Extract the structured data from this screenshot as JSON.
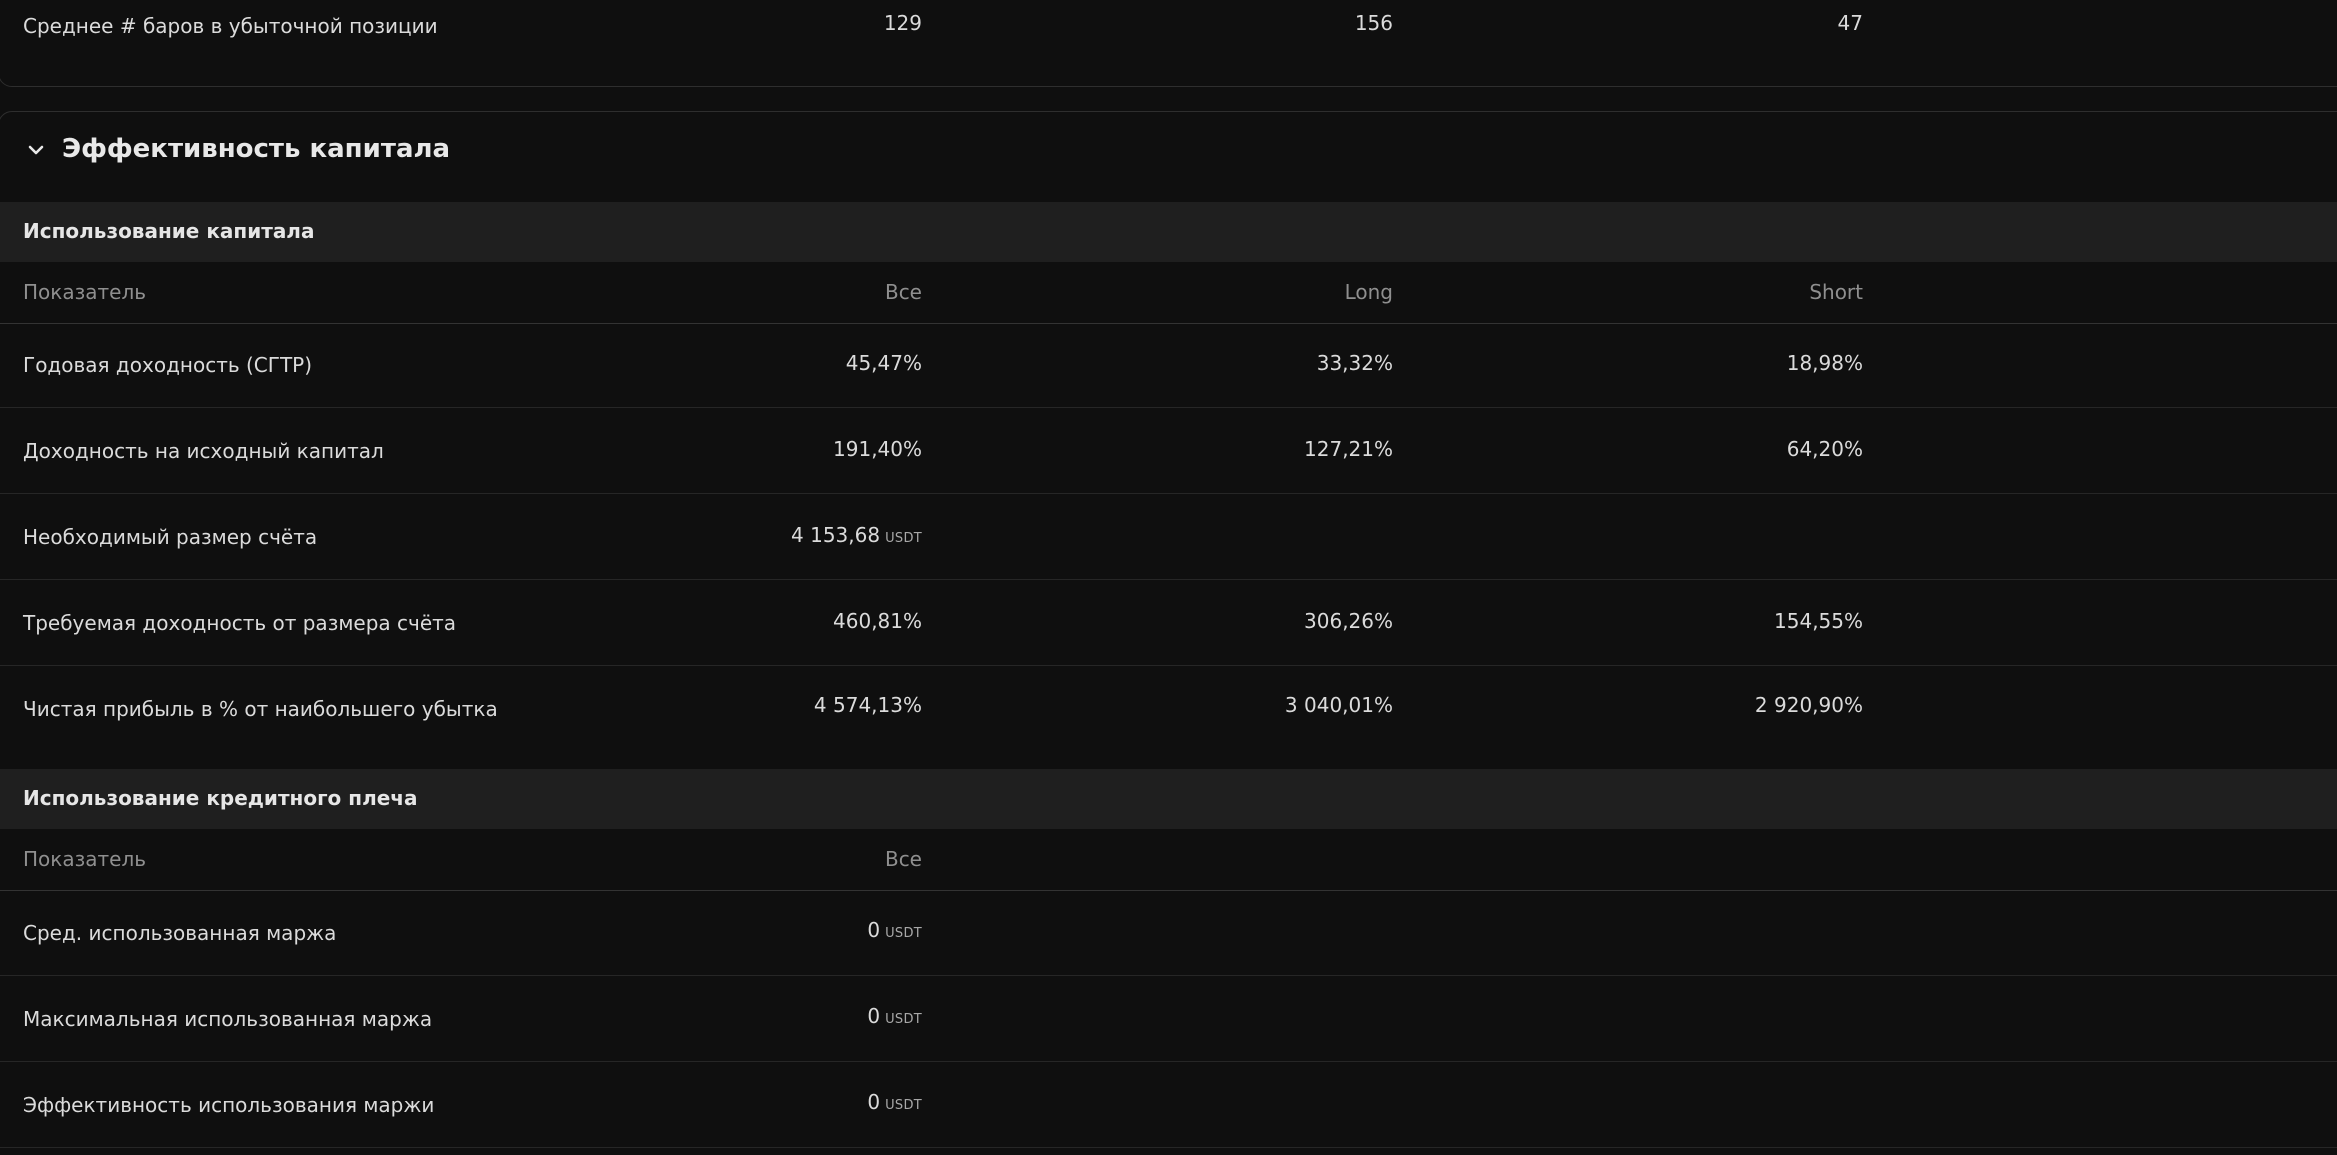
{
  "top_row": {
    "label": "Среднее # баров в убыточной позиции",
    "all": "129",
    "long": "156",
    "short": "47"
  },
  "section": {
    "title": "Эффективность капитала",
    "toggle_icon": "chevron-down-icon"
  },
  "capital_usage": {
    "title": "Использование капитала",
    "headers": {
      "metric": "Показатель",
      "all": "Все",
      "long": "Long",
      "short": "Short"
    },
    "rows": [
      {
        "label": "Годовая доходность (CГТР)",
        "all": "45,47%",
        "long": "33,32%",
        "short": "18,98%"
      },
      {
        "label": "Доходность на исходный капитал",
        "all": "191,40%",
        "long": "127,21%",
        "short": "64,20%"
      },
      {
        "label": "Необходимый размер счёта",
        "all": "4 153,68",
        "all_unit": "USDT",
        "long": "",
        "short": ""
      },
      {
        "label": "Требуемая доходность от размера счёта",
        "all": "460,81%",
        "long": "306,26%",
        "short": "154,55%"
      },
      {
        "label": "Чистая прибыль в % от наибольшего убытка",
        "all": "4 574,13%",
        "long": "3 040,01%",
        "short": "2 920,90%"
      }
    ]
  },
  "leverage_usage": {
    "title": "Использование кредитного плеча",
    "headers": {
      "metric": "Показатель",
      "all": "Все"
    },
    "rows": [
      {
        "label": "Сред. использованная маржа",
        "all": "0",
        "all_unit": "USDT"
      },
      {
        "label": "Максимальная использованная маржа",
        "all": "0",
        "all_unit": "USDT"
      },
      {
        "label": "Эффективность использования маржи",
        "all": "0",
        "all_unit": "USDT"
      }
    ]
  },
  "colors": {
    "background": "#0f0f0f",
    "group_header_bg": "#1f1f1f",
    "text": "#dbdbdb",
    "muted_text": "#8f8f8f",
    "border": "#2e2e2e"
  }
}
